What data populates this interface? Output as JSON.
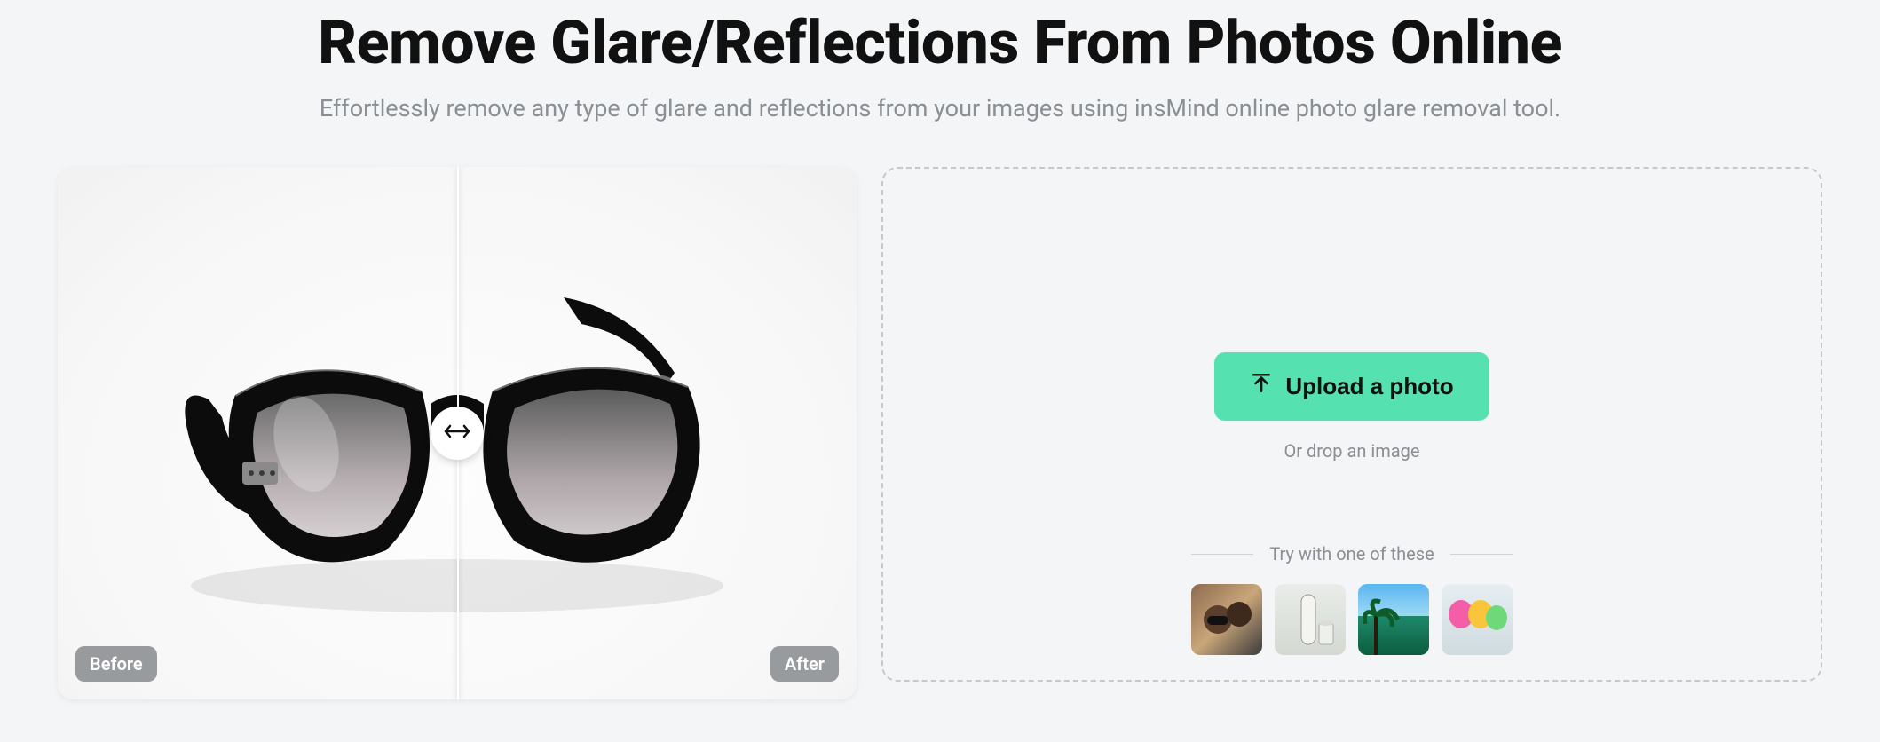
{
  "header": {
    "title": "Remove Glare/Reflections From Photos Online",
    "subtitle": "Effortlessly remove any type of glare and reflections from your images using insMind online photo glare removal tool."
  },
  "preview": {
    "before_label": "Before",
    "after_label": "After"
  },
  "upload": {
    "button_label": "Upload a photo",
    "drop_label": "Or drop an image",
    "samples_label": "Try with one of these",
    "samples": [
      {
        "name": "couple-sunglasses"
      },
      {
        "name": "bottle-glass"
      },
      {
        "name": "palm-beach"
      },
      {
        "name": "colorful-drinks"
      }
    ]
  }
}
